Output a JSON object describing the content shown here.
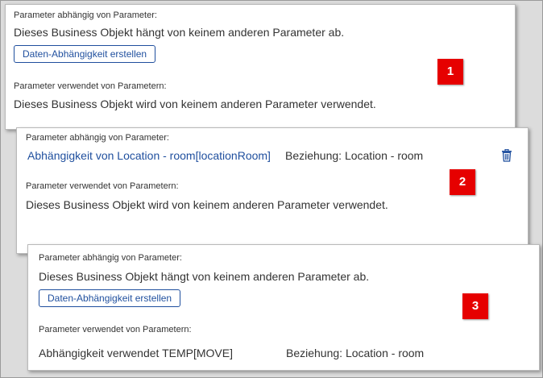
{
  "panels": [
    {
      "badge": "1",
      "depends_label": "Parameter abhängig von Parameter:",
      "depends_text": "Dieses Business Objekt hängt von keinem anderen Parameter ab.",
      "create_button": "Daten-Abhängigkeit erstellen",
      "used_label": "Parameter verwendet von Parametern:",
      "used_text": "Dieses Business Objekt wird von keinem anderen Parameter verwendet."
    },
    {
      "badge": "2",
      "depends_label": "Parameter abhängig von Parameter:",
      "dependency_link": "Abhängigkeit von Location - room[locationRoom]",
      "dependency_relation": "Beziehung: Location - room",
      "delete_icon": "trash-icon",
      "used_label": "Parameter verwendet von Parametern:",
      "used_text": "Dieses Business Objekt wird von keinem anderen Parameter verwendet."
    },
    {
      "badge": "3",
      "depends_label": "Parameter abhängig von Parameter:",
      "depends_text": "Dieses Business Objekt hängt von keinem anderen Parameter ab.",
      "create_button": "Daten-Abhängigkeit erstellen",
      "used_label": "Parameter verwendet von Parametern:",
      "used_item": "Abhängigkeit verwendet TEMP[MOVE]",
      "used_relation": "Beziehung: Location - room"
    }
  ],
  "colors": {
    "accent": "#1f4f9e",
    "badge": "#e60000"
  }
}
